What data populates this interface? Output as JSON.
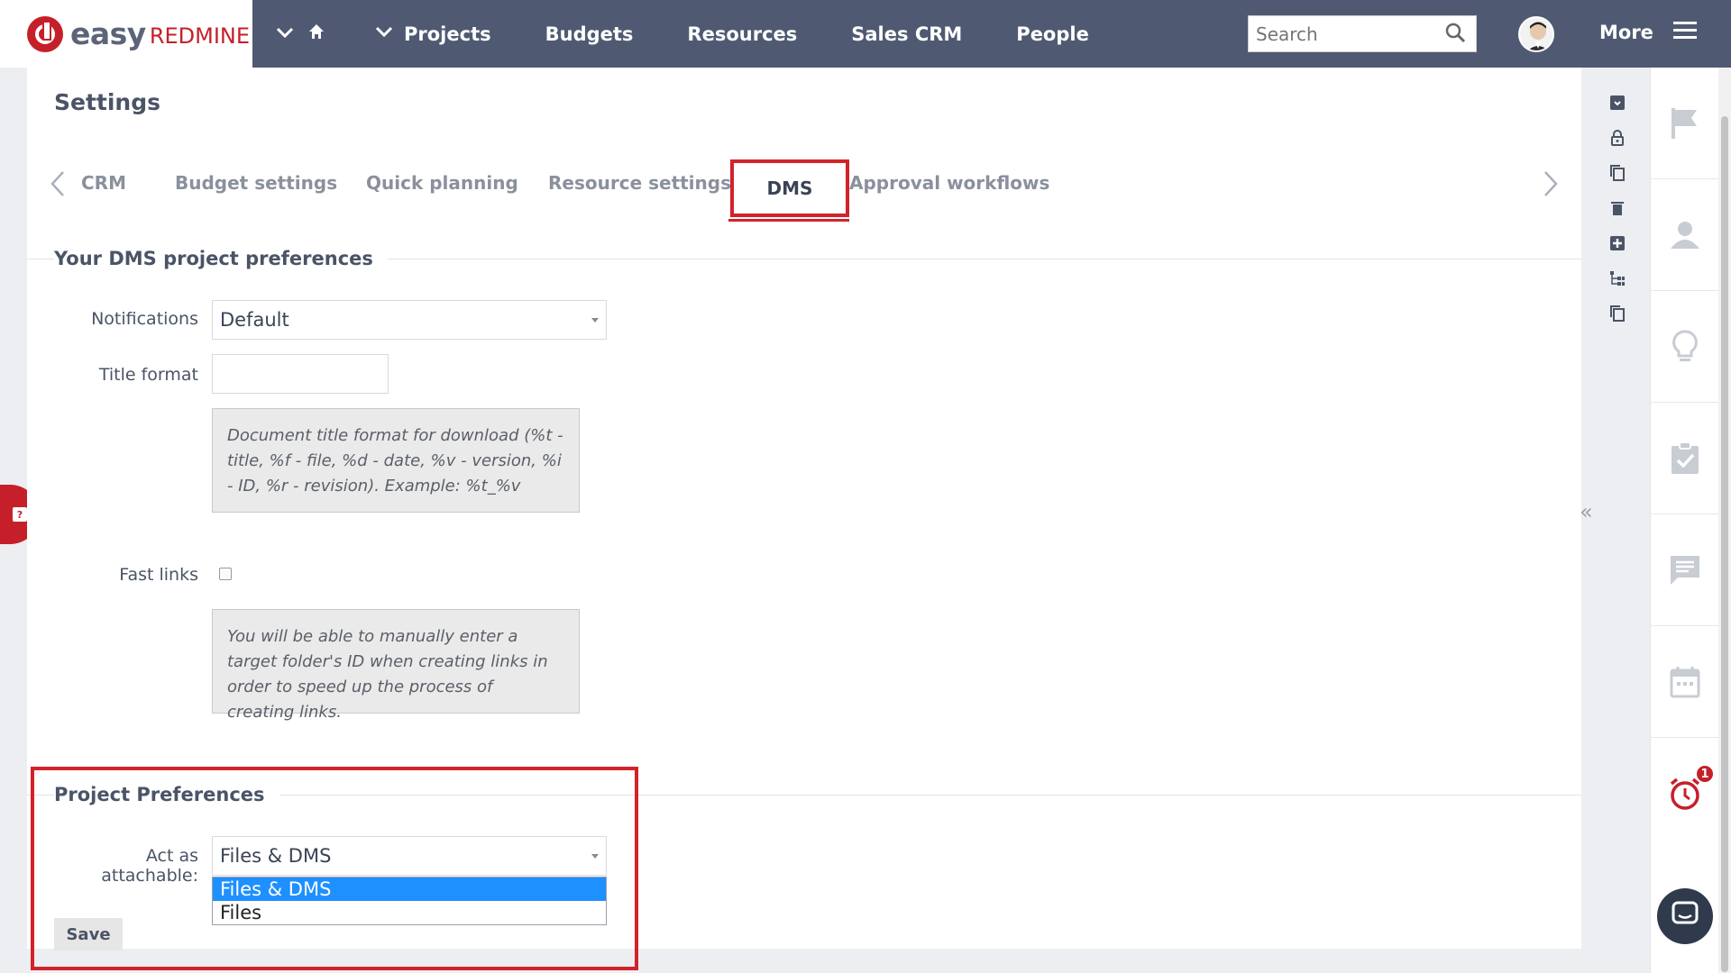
{
  "app": {
    "logo_easy": "easy",
    "logo_redmine": "REDMINE"
  },
  "nav": {
    "items": [
      "Projects",
      "Budgets",
      "Resources",
      "Sales CRM",
      "People"
    ],
    "more_label": "More"
  },
  "search": {
    "placeholder": "Search"
  },
  "page": {
    "title": "Settings"
  },
  "tabs": {
    "items": [
      "CRM",
      "Budget settings",
      "Quick planning",
      "Resource settings",
      "DMS",
      "Approval workflows"
    ],
    "active": "DMS"
  },
  "dms_prefs": {
    "title": "Your DMS project preferences",
    "notifications_label": "Notifications",
    "notifications_value": "Default",
    "title_format_label": "Title format",
    "title_format_value": "",
    "title_format_hint": "Document title format for download (%t - title, %f - file, %d - date, %v - version, %i - ID, %r - revision). Example: %t_%v",
    "fast_links_label": "Fast links",
    "fast_links_checked": false,
    "fast_links_hint": "You will be able to manually enter a target folder's ID when creating links in order to speed up the process of creating links."
  },
  "project_prefs": {
    "title": "Project Preferences",
    "act_as_attachable_label": "Act as attachable:",
    "act_as_attachable_value": "Files & DMS",
    "options": [
      "Files & DMS",
      "Files"
    ],
    "save_label": "Save"
  },
  "sidebar": {
    "reminder_badge": "1"
  },
  "colors": {
    "topbar": "#4f5a72",
    "brand_red": "#c5202a",
    "highlight_red": "#d2232a",
    "selected_option": "#1e90ff"
  },
  "icons": [
    "home-icon",
    "search-icon",
    "hamburger-icon",
    "flag-icon",
    "person-icon",
    "lightbulb-icon",
    "clipboard-check-icon",
    "comment-icon",
    "calendar-icon",
    "alarm-icon",
    "chat-icon"
  ]
}
